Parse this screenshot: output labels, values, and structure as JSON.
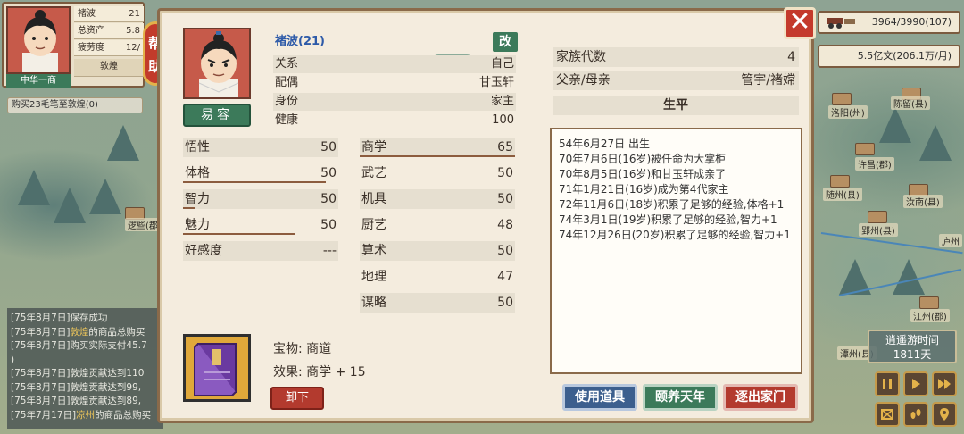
{
  "player": {
    "name": "褚波",
    "name_value": "21",
    "assets_label": "总资产",
    "assets_value": "5.8",
    "fatigue_label": "疲劳度",
    "fatigue_value": "12/",
    "family_label": "中华一商",
    "location": "敦煌"
  },
  "help_button": [
    "帮",
    "助"
  ],
  "task_text": "购买23毛笔至敦煌(0)",
  "log": [
    {
      "text": "[75年8月7日]保存成功",
      "hl": ""
    },
    {
      "text": "[75年8月7日]",
      "hl": "敦煌",
      "rest": "的商品总购买"
    },
    {
      "text": "[75年8月7日]购买实际支付45.7",
      "hl": ""
    },
    {
      "text": ")",
      "hl": ""
    },
    {
      "text": "[75年8月7日]敦煌贡献达到110",
      "hl": ""
    },
    {
      "text": "[75年8月7日]敦煌贡献达到99,",
      "hl": ""
    },
    {
      "text": "[75年8月7日]敦煌贡献达到89,",
      "hl": ""
    },
    {
      "text": "[75年7月17日]",
      "hl": "凉州",
      "rest": "的商品总购买"
    }
  ],
  "hud": {
    "cargo": "3964/3990(107)",
    "money": "5.5亿文(206.1万/月)",
    "time_label": "逍遥游时间",
    "time_value": "1811天"
  },
  "map_labels": [
    "洛阳(州)",
    "陈留(县)",
    "许昌(郡)",
    "汝南(县)",
    "随州(县)",
    "郢州(县)",
    "庐州",
    "江州(郡)",
    "潭州(县)",
    "逻些(郡)"
  ],
  "modal": {
    "face_button": "易容",
    "name_line": "褚波(21)",
    "edit_button": "改",
    "info": [
      {
        "label": "关系",
        "value": "自己"
      },
      {
        "label": "配偶",
        "value": "甘玉轩"
      },
      {
        "label": "身份",
        "value": "家主"
      },
      {
        "label": "健康",
        "value": "100"
      }
    ],
    "attrs_left": [
      {
        "label": "悟性",
        "value": "50",
        "bar": 0
      },
      {
        "label": "体格",
        "value": "50",
        "bar": 0.92
      },
      {
        "label": "智力",
        "value": "50",
        "bar": 0.08
      },
      {
        "label": "魅力",
        "value": "50",
        "bar": 0.72
      },
      {
        "label": "好感度",
        "value": "---",
        "bar": 0
      }
    ],
    "attrs_right": [
      {
        "label": "商学",
        "value": "65",
        "bar": 1
      },
      {
        "label": "武艺",
        "value": "50",
        "bar": 0
      },
      {
        "label": "机具",
        "value": "50",
        "bar": 0
      },
      {
        "label": "厨艺",
        "value": "48",
        "bar": 0
      },
      {
        "label": "算术",
        "value": "50",
        "bar": 0
      },
      {
        "label": "地理",
        "value": "47",
        "bar": 0
      },
      {
        "label": "谋略",
        "value": "50",
        "bar": 0
      }
    ],
    "item": {
      "name_line": "宝物: 商道",
      "effect_line": "效果: 商学 + 15",
      "unequip": "卸下"
    },
    "family": {
      "generations_label": "家族代数",
      "generations_value": "4",
      "parents_label": "父亲/母亲",
      "parents_value": "管宇/褚嫦"
    },
    "life_title": "生平",
    "life_events": [
      "54年6月27日 出生",
      "70年7月6日(16岁)被任命为大掌柜",
      "70年8月5日(16岁)和甘玉轩成亲了",
      "71年1月21日(16岁)成为第4代家主",
      "72年11月6日(18岁)积累了足够的经验,体格+1",
      "74年3月1日(19岁)积累了足够的经验,智力+1",
      "74年12月26日(20岁)积累了足够的经验,智力+1"
    ],
    "buttons": {
      "use_item": "使用道具",
      "retire": "颐养天年",
      "expel": "逐出家门"
    }
  },
  "colors": {
    "accent_red": "#c43a2c",
    "accent_green": "#3c7a5a",
    "accent_blue": "#3c5f8e",
    "name_blue": "#2d5aa8",
    "panel": "#f4ecde"
  }
}
